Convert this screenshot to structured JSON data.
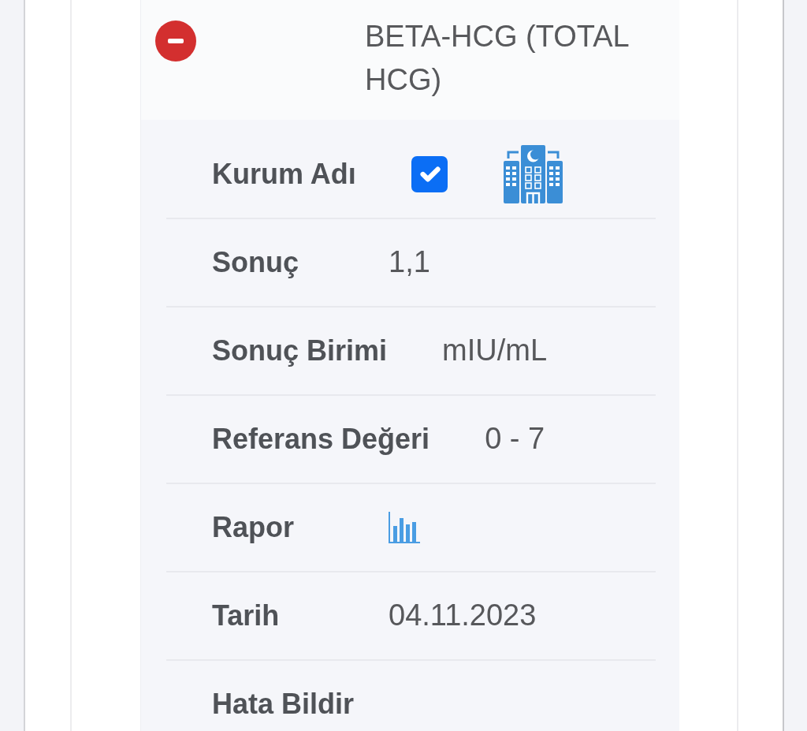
{
  "test": {
    "expanded": true,
    "title": "BETA-HCG (TOTAL HCG)"
  },
  "fields": [
    {
      "kind": "institution",
      "label": "Kurum Adı",
      "checked": true
    },
    {
      "kind": "text",
      "label": "Sonuç",
      "value": "1,1"
    },
    {
      "kind": "text",
      "label": "Sonuç Birimi",
      "value": "mIU/mL"
    },
    {
      "kind": "text",
      "label": "Referans Değeri",
      "value": "0 - 7"
    },
    {
      "kind": "report",
      "label": "Rapor"
    },
    {
      "kind": "text",
      "label": "Tarih",
      "value": "04.11.2023"
    },
    {
      "kind": "text",
      "label": "Hata Bildir"
    }
  ]
}
